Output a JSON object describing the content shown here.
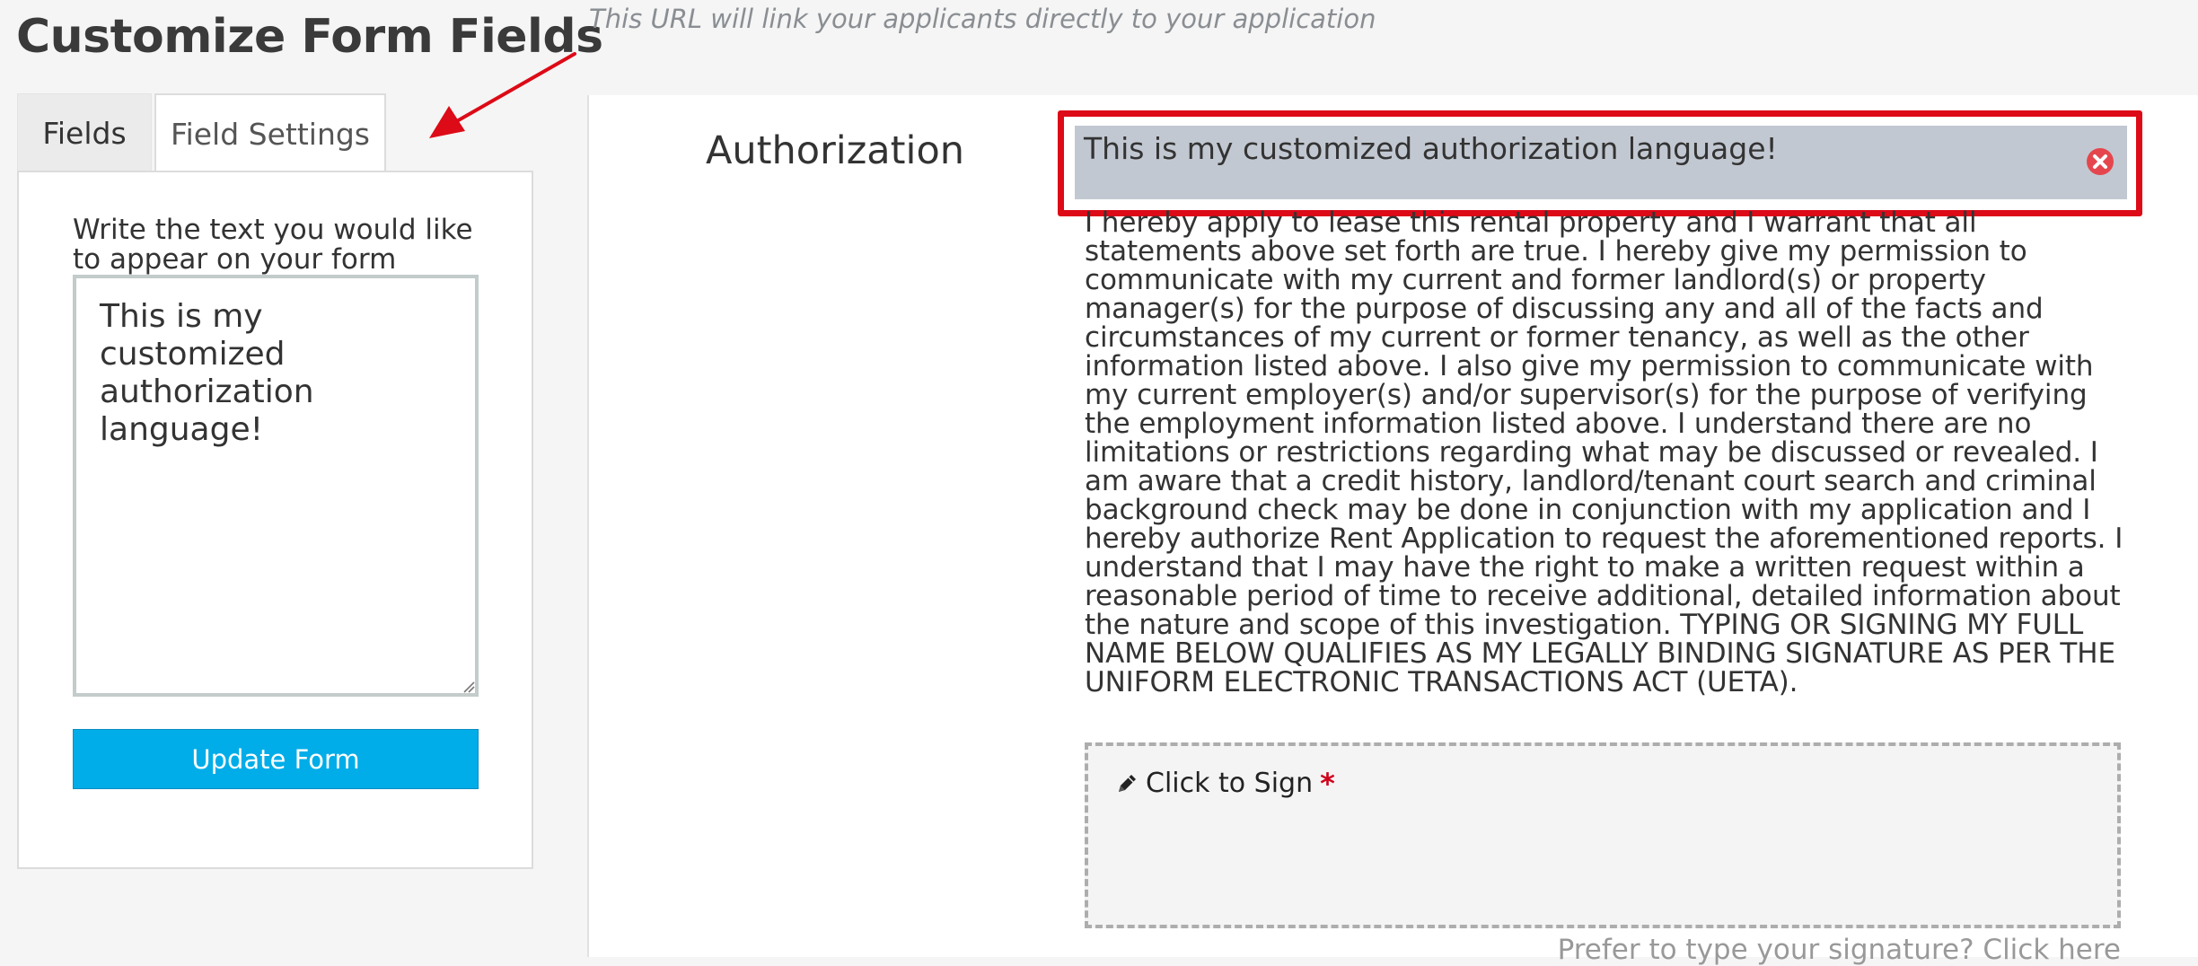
{
  "page": {
    "title": "Customize Form Fields",
    "url_note": "This URL will link your applicants directly to your application"
  },
  "tabs": [
    {
      "label": "Fields",
      "active": false
    },
    {
      "label": "Field Settings",
      "active": true
    }
  ],
  "settings": {
    "label": "Write the text you would like to appear on your form",
    "textarea_value": "This is my customized authorization language!",
    "update_button": "Update Form"
  },
  "authorization": {
    "section_label": "Authorization",
    "custom_text": "This is my customized authorization language!",
    "body": "I hereby apply to lease this rental property and I warrant that all statements above set forth are true. I hereby give my permission to communicate with my current and former landlord(s) or property manager(s) for the purpose of discussing any and all of the facts and circumstances of my current or former tenancy, as well as the other information listed above. I also give my permission to communicate with my current employer(s) and/or supervisor(s) for the purpose of verifying the employment information listed above. I understand there are no limitations or restrictions regarding what may be discussed or revealed. I am aware that a credit history, landlord/tenant court search and criminal background check may be done in conjunction with my application and I hereby authorize Rent Application to request the aforementioned reports. I understand that I may have the right to make a written request within a reasonable period of time to receive additional, detailed information about the nature and scope of this investigation. TYPING OR SIGNING MY FULL NAME BELOW QUALIFIES AS MY LEGALLY BINDING SIGNATURE AS PER THE UNIFORM ELECTRONIC TRANSACTIONS ACT (UETA).",
    "sign_label": "Click to Sign",
    "required_mark": "*",
    "type_link": "Prefer to type your signature? Click here"
  },
  "colors": {
    "accent_blue": "#00ade8",
    "highlight_red": "#dd0a17",
    "custom_bar": "#c2c8d1",
    "remove_icon": "#e5464d"
  },
  "icons": {
    "annotation": "red-arrow-icon",
    "remove": "close-circle-icon",
    "sign": "pencil-icon",
    "textarea": "resize-grip-icon"
  }
}
